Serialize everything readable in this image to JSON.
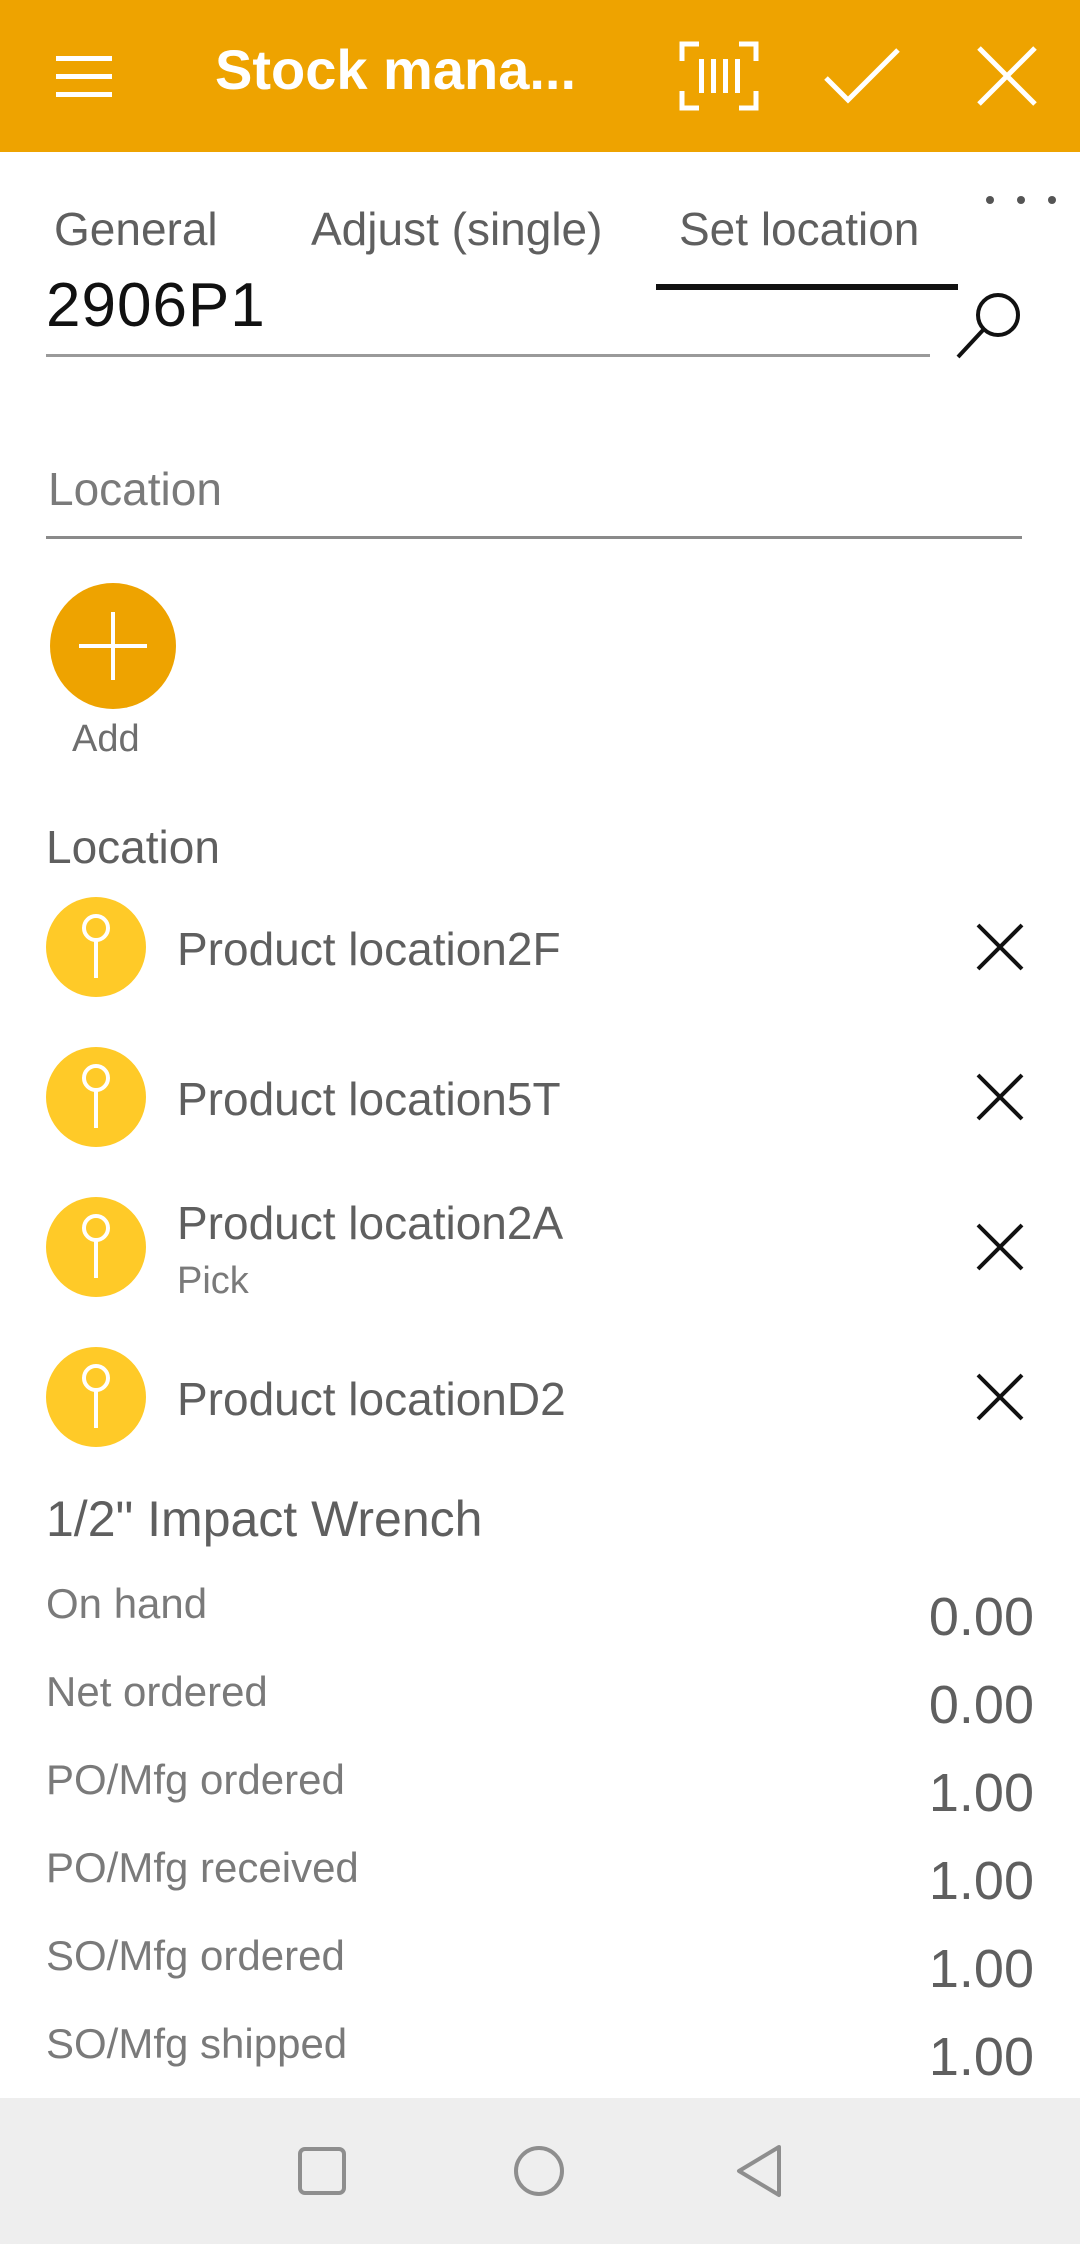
{
  "appbar": {
    "title": "Stock mana...",
    "icons": [
      "menu-icon",
      "barcode-scan-icon",
      "checkmark-icon",
      "close-icon"
    ],
    "color": "#eea300"
  },
  "tabs": {
    "items": [
      {
        "label": "General"
      },
      {
        "label": "Adjust (single)"
      },
      {
        "label": "Set location"
      }
    ],
    "active": "Set location",
    "more_icon": "more-horizontal-icon"
  },
  "search": {
    "value": "2906P1",
    "icon": "search-icon"
  },
  "location_input": {
    "placeholder": "Location"
  },
  "add_button": {
    "label": "Add",
    "icon": "plus-icon"
  },
  "locations": {
    "title": "Location",
    "items": [
      {
        "name": "Product location2F",
        "sub": ""
      },
      {
        "name": "Product location5T",
        "sub": ""
      },
      {
        "name": "Product location2A",
        "sub": "Pick"
      },
      {
        "name": "Product locationD2",
        "sub": ""
      }
    ],
    "pin_color": "#ffca28"
  },
  "product": {
    "name": "1/2\" Impact Wrench",
    "details": [
      {
        "label": "On hand",
        "value": "0.00"
      },
      {
        "label": "Net ordered",
        "value": "0.00"
      },
      {
        "label": "PO/Mfg ordered",
        "value": "1.00"
      },
      {
        "label": "PO/Mfg received",
        "value": "1.00"
      },
      {
        "label": "SO/Mfg ordered",
        "value": "1.00"
      },
      {
        "label": "SO/Mfg shipped",
        "value": "1.00"
      }
    ]
  },
  "navbar": {
    "icons": [
      "recents-square-icon",
      "home-circle-icon",
      "back-triangle-icon"
    ]
  }
}
